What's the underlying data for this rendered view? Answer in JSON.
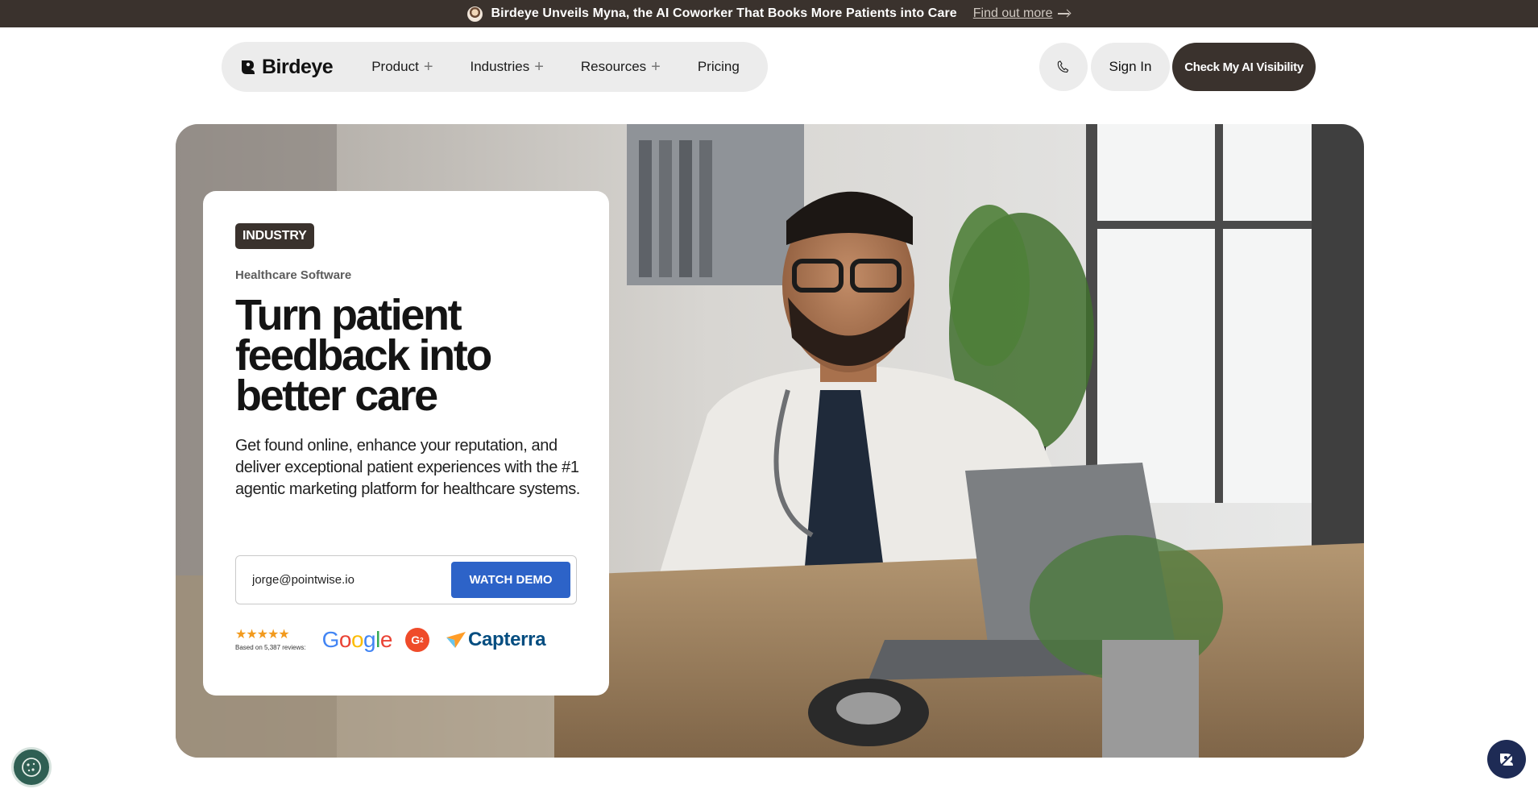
{
  "announcement": {
    "message": "Birdeye Unveils Myna, the AI Coworker That Books More Patients into Care",
    "link_label": "Find out more"
  },
  "header": {
    "logo_text": "Birdeye",
    "nav": [
      {
        "label": "Product",
        "icon": "plus-icon"
      },
      {
        "label": "Industries",
        "icon": "plus-icon"
      },
      {
        "label": "Resources",
        "icon": "plus-icon"
      },
      {
        "label": "Pricing"
      }
    ],
    "phone_icon": "phone-icon",
    "signin_label": "Sign In",
    "cta_label": "Check My AI Visibility"
  },
  "hero": {
    "tag": "INDUSTRY",
    "subtitle": "Healthcare Software",
    "headline": "Turn patient feedback into better care",
    "description": "Get found online, enhance your reputation, and deliver exceptional patient experiences with the #1 agentic marketing platform for healthcare systems.",
    "email_value": "jorge@pointwise.io",
    "demo_button": "WATCH DEMO",
    "rating": {
      "stars": "★★★★★",
      "stars_value": 4.5,
      "based_on": "Based on 5,387 reviews:",
      "platforms": [
        "Google",
        "G2",
        "Capterra"
      ]
    }
  },
  "floating": {
    "cookie_icon": "cookie-icon",
    "chat_icon": "chat-assistant-icon"
  },
  "colors": {
    "dark_brown": "#3a322d",
    "blue_button": "#2d63c8",
    "star_orange": "#f29a1d",
    "pill_gray": "#ececec"
  }
}
